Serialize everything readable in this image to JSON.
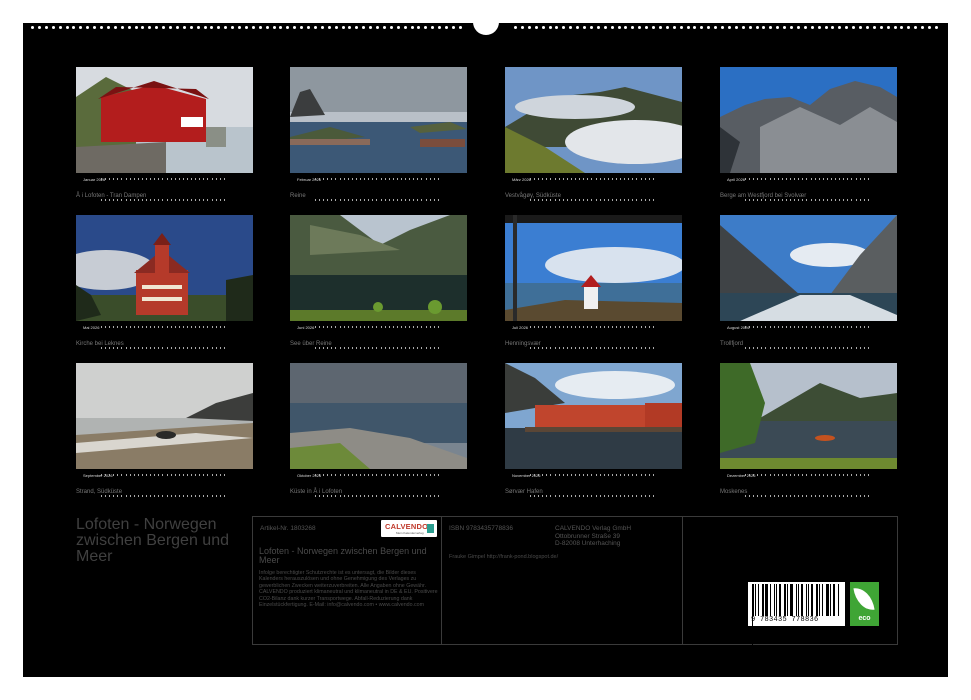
{
  "months": [
    {
      "name": "Januar 2026",
      "caption": "Å i Lofoten - Tran Dampen"
    },
    {
      "name": "Februar 2026",
      "caption": "Reine"
    },
    {
      "name": "März 2026",
      "caption": "Vestvågøy, Südküste"
    },
    {
      "name": "April 2026",
      "caption": "Berge am Westfjord bei Svolvær"
    },
    {
      "name": "Mai 2026",
      "caption": "Kirche bei Leknes"
    },
    {
      "name": "Juni 2026",
      "caption": "See über Reine"
    },
    {
      "name": "Juli 2026",
      "caption": "Henningsvær"
    },
    {
      "name": "August 2026",
      "caption": "Trollfjord"
    },
    {
      "name": "September 2026",
      "caption": "Strand, Südküste"
    },
    {
      "name": "Oktober 2026",
      "caption": "Küste in Å i Lofoten"
    },
    {
      "name": "November 2026",
      "caption": "Sørvær Hafen"
    },
    {
      "name": "Dezember 2026",
      "caption": "Moskenes"
    }
  ],
  "title": "Lofoten - Norwegen zwischen Bergen und Meer",
  "info": {
    "art_nr": "Artikel-Nr. 1803268",
    "logo": "CALVENDO",
    "logo_sub": "Mein Kalenderverlag",
    "subtitle": "Lofoten - Norwegen zwischen Bergen und Meer",
    "legal": "Infolge berechtigter Schutzrechte ist es untersagt, die Bilder dieses Kalenders herauszulösen und ohne Genehmigung des Verlages zu gewerblichen Zwecken weiterzuverbreiten. Alle Angaben ohne Gewähr. CALVENDO produziert klimaneutral und klimaneutral in DE & EU. Positivere CO2-Bilanz dank kurzer Transportwege. Abfall-Reduzierung dank Einzelstückfertigung. E-Mail: info@calvendo.com • www.calvendo.com",
    "isbn": "ISBN 9783435778836",
    "publisher_lines": [
      "CALVENDO Verlag GmbH",
      "Ottobrunner Straße 39",
      "D-82008 Unterhaching"
    ],
    "author": "Frauke Gimpel http://frank-pond.blogspot.de/",
    "barcode_number": "9 783435 778836",
    "eco": "eco"
  }
}
